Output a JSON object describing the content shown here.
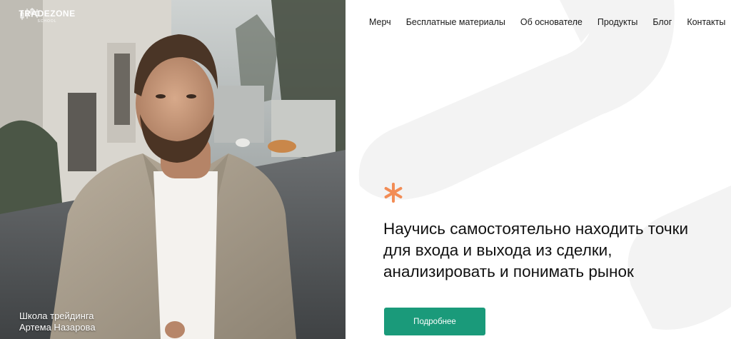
{
  "brand": {
    "name": "TRADEZONE",
    "sub": "SCHOOL"
  },
  "nav": {
    "items": [
      {
        "label": "Мерч"
      },
      {
        "label": "Бесплатные материалы"
      },
      {
        "label": "Об основателе"
      },
      {
        "label": "Продукты"
      },
      {
        "label": "Блог"
      },
      {
        "label": "Контакты"
      }
    ]
  },
  "hero": {
    "caption_line1": "Школа трейдинга",
    "caption_line2": "Артема Назарова",
    "headline_line1": "Научись самостоятельно находить точки",
    "headline_line2": "для входа и выхода из сделки,",
    "headline_line3": "анализировать и понимать рынок",
    "cta_label": "Подробнее",
    "accent_icon": "asterisk-icon"
  },
  "colors": {
    "accent_orange": "#f28c55",
    "button_green": "#1a9a7a",
    "bg_shape_gray": "#f3f3f3"
  }
}
